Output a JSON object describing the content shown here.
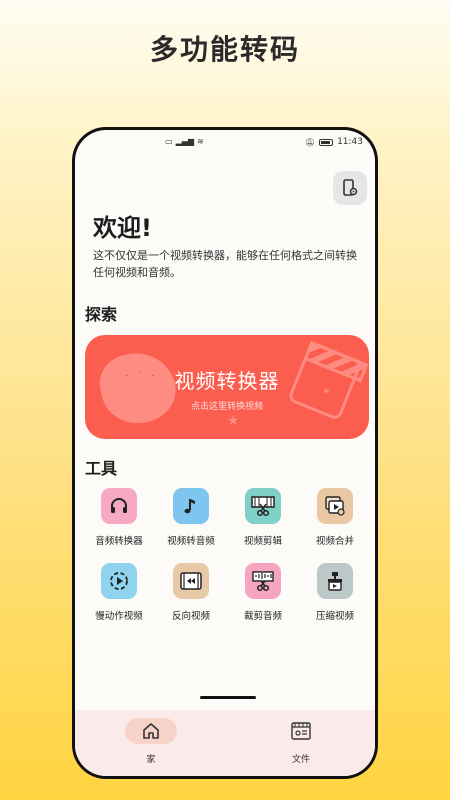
{
  "promo": {
    "title": "多功能转码"
  },
  "status_bar": {
    "time": "11:43"
  },
  "welcome": {
    "title": "欢迎!",
    "text": "这不仅仅是一个视频转换器，能够在任何格式之间转换任何视频和音频。"
  },
  "explore": {
    "section_title": "探索",
    "banner_title": "视频转换器",
    "banner_subtitle": "点击这里转换视频",
    "banner_color": "#fb5d4e"
  },
  "tools": {
    "section_title": "工具",
    "items": [
      {
        "label": "音频转换器",
        "icon": "headphones-icon",
        "color": "#f7a8c2"
      },
      {
        "label": "视频转音频",
        "icon": "music-note-icon",
        "color": "#7ec6f0"
      },
      {
        "label": "视频剪辑",
        "icon": "film-cut-icon",
        "color": "#7fd0c6"
      },
      {
        "label": "视频合并",
        "icon": "video-merge-icon",
        "color": "#e9c8a3"
      },
      {
        "label": "慢动作视频",
        "icon": "slow-motion-icon",
        "color": "#8fd3ee"
      },
      {
        "label": "反向视频",
        "icon": "reverse-video-icon",
        "color": "#e7c9a7"
      },
      {
        "label": "裁剪音频",
        "icon": "audio-trim-icon",
        "color": "#f6a5c0"
      },
      {
        "label": "压缩视频",
        "icon": "compress-video-icon",
        "color": "#bcc8c8"
      }
    ]
  },
  "bottom_nav": {
    "items": [
      {
        "label": "家",
        "icon": "home-icon",
        "active": true
      },
      {
        "label": "文件",
        "icon": "files-icon",
        "active": false
      }
    ],
    "active_color": "#f7d2c8"
  }
}
